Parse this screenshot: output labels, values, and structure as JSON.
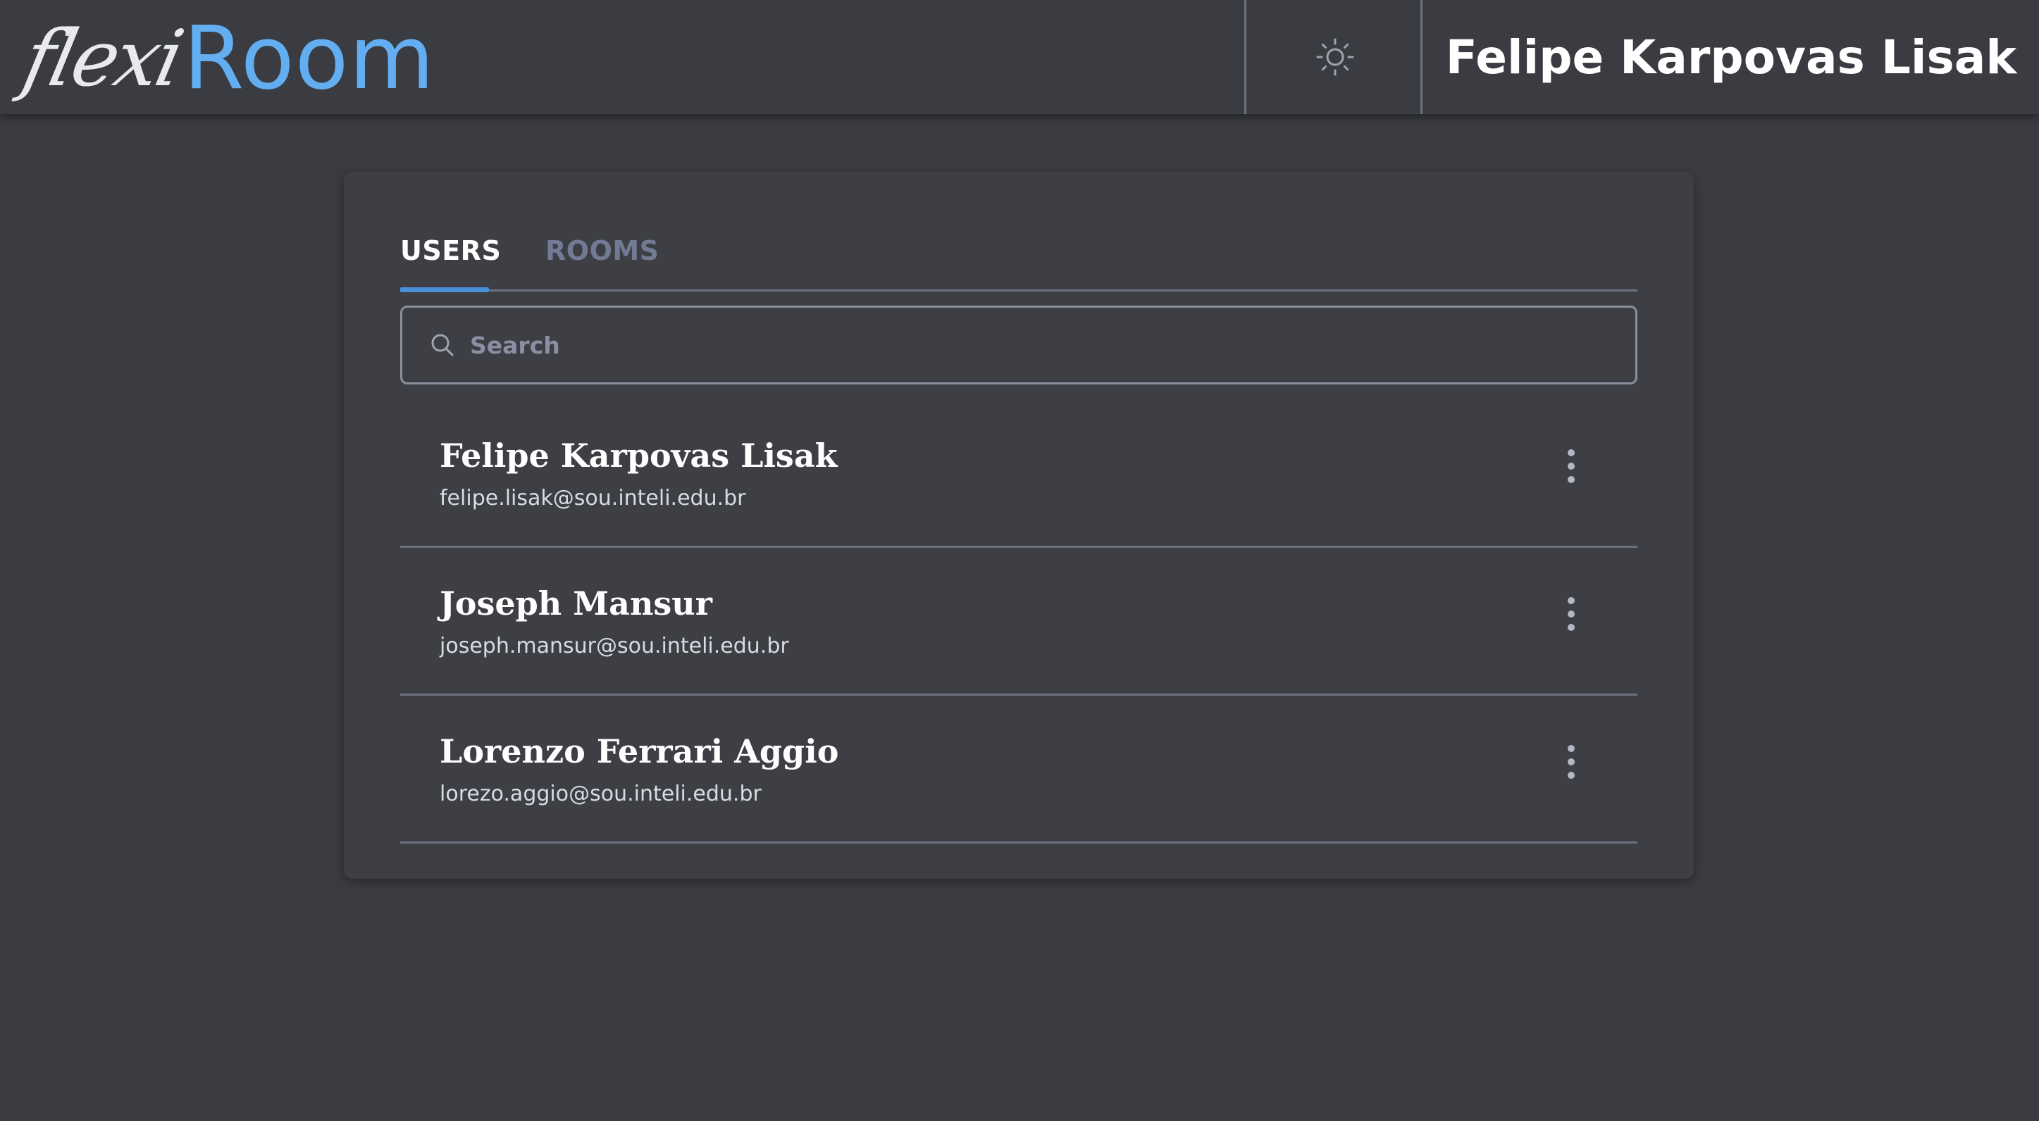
{
  "header": {
    "logo_script": "flexi",
    "logo_room": "Room",
    "theme_icon": "sun-icon",
    "user_name": "Felipe Karpovas Lisak"
  },
  "tabs": [
    {
      "label": "USERS",
      "active": true
    },
    {
      "label": "ROOMS",
      "active": false
    }
  ],
  "search": {
    "placeholder": "Search",
    "value": "",
    "icon": "search-icon"
  },
  "users": [
    {
      "name": "Felipe Karpovas Lisak",
      "email": "felipe.lisak@sou.inteli.edu.br"
    },
    {
      "name": "Joseph Mansur",
      "email": "joseph.mansur@sou.inteli.edu.br"
    },
    {
      "name": "Lorenzo Ferrari Aggio",
      "email": "lorezo.aggio@sou.inteli.edu.br"
    }
  ],
  "colors": {
    "background": "#3a3c42",
    "accent": "#62aef0",
    "tab_indicator": "#4a90d9",
    "divider": "#6c7080"
  }
}
